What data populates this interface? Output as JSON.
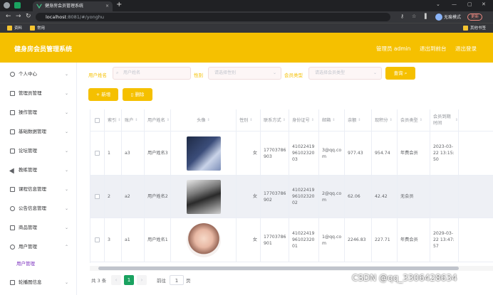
{
  "browser": {
    "tab_title": "健身房会员管理系统",
    "url_host": "localhost",
    "url_rest": ":8081/#/yonghu",
    "incognito_label": "无痕模式",
    "update_label": "更新",
    "bookmarks": [
      "资料",
      "常用"
    ],
    "other_bookmarks": "其他书签"
  },
  "header": {
    "brand": "健身房会员管理系统",
    "admin_label": "管理员 admin",
    "back_label": "退出到前台",
    "logout_label": "退出登录"
  },
  "sidebar": {
    "items": [
      {
        "label": "个人中心"
      },
      {
        "label": "管理员管理"
      },
      {
        "label": "操作管理"
      },
      {
        "label": "基础数据管理"
      },
      {
        "label": "论坛管理"
      },
      {
        "label": "教练管理"
      },
      {
        "label": "课程信息管理"
      },
      {
        "label": "公告信息管理"
      },
      {
        "label": "商品管理"
      },
      {
        "label": "用户管理"
      },
      {
        "label": "轮播图信息"
      }
    ],
    "active_sub": "用户管理"
  },
  "filters": {
    "name_label": "用户姓名",
    "name_placeholder": "用户姓名",
    "gender_label": "性别",
    "gender_placeholder": "请选择性别",
    "member_label": "会员类型",
    "member_placeholder": "请选择会员类型",
    "search_button": "查询"
  },
  "actions": {
    "add": "新增",
    "delete": "删除"
  },
  "table": {
    "headers": [
      "索引",
      "账户",
      "用户姓名",
      "头像",
      "性别",
      "联系方式",
      "身份证号",
      "邮箱",
      "余额",
      "现积分",
      "会员类型",
      "会员到期时间"
    ],
    "rows": [
      {
        "index": "1",
        "account": "a3",
        "name": "用户姓名3",
        "gender": "女",
        "phone": "17703786903",
        "idcard": "410224199610232003",
        "email": "3@qq.com",
        "balance": "977.43",
        "points": "954.74",
        "member": "年费会员",
        "expire": "2023-03-22 13:15:50"
      },
      {
        "index": "2",
        "account": "a2",
        "name": "用户姓名2",
        "gender": "女",
        "phone": "17703786902",
        "idcard": "410224199610232002",
        "email": "2@qq.com",
        "balance": "62.06",
        "points": "42.42",
        "member": "无会员",
        "expire": ""
      },
      {
        "index": "3",
        "account": "a1",
        "name": "用户姓名1",
        "gender": "女",
        "phone": "17703786901",
        "idcard": "410224199610232001",
        "email": "1@qq.com",
        "balance": "2246.83",
        "points": "227.71",
        "member": "年费会员",
        "expire": "2029-03-22 13:47:57"
      }
    ]
  },
  "pagination": {
    "total": "共 3 条",
    "current": "1",
    "goto": "前往",
    "page_input": "1",
    "page_unit": "页"
  },
  "watermark": "CSDN @qq_3306428634",
  "colors": {
    "accent": "#f5c000",
    "submenu_active": "#7b2fbe"
  }
}
